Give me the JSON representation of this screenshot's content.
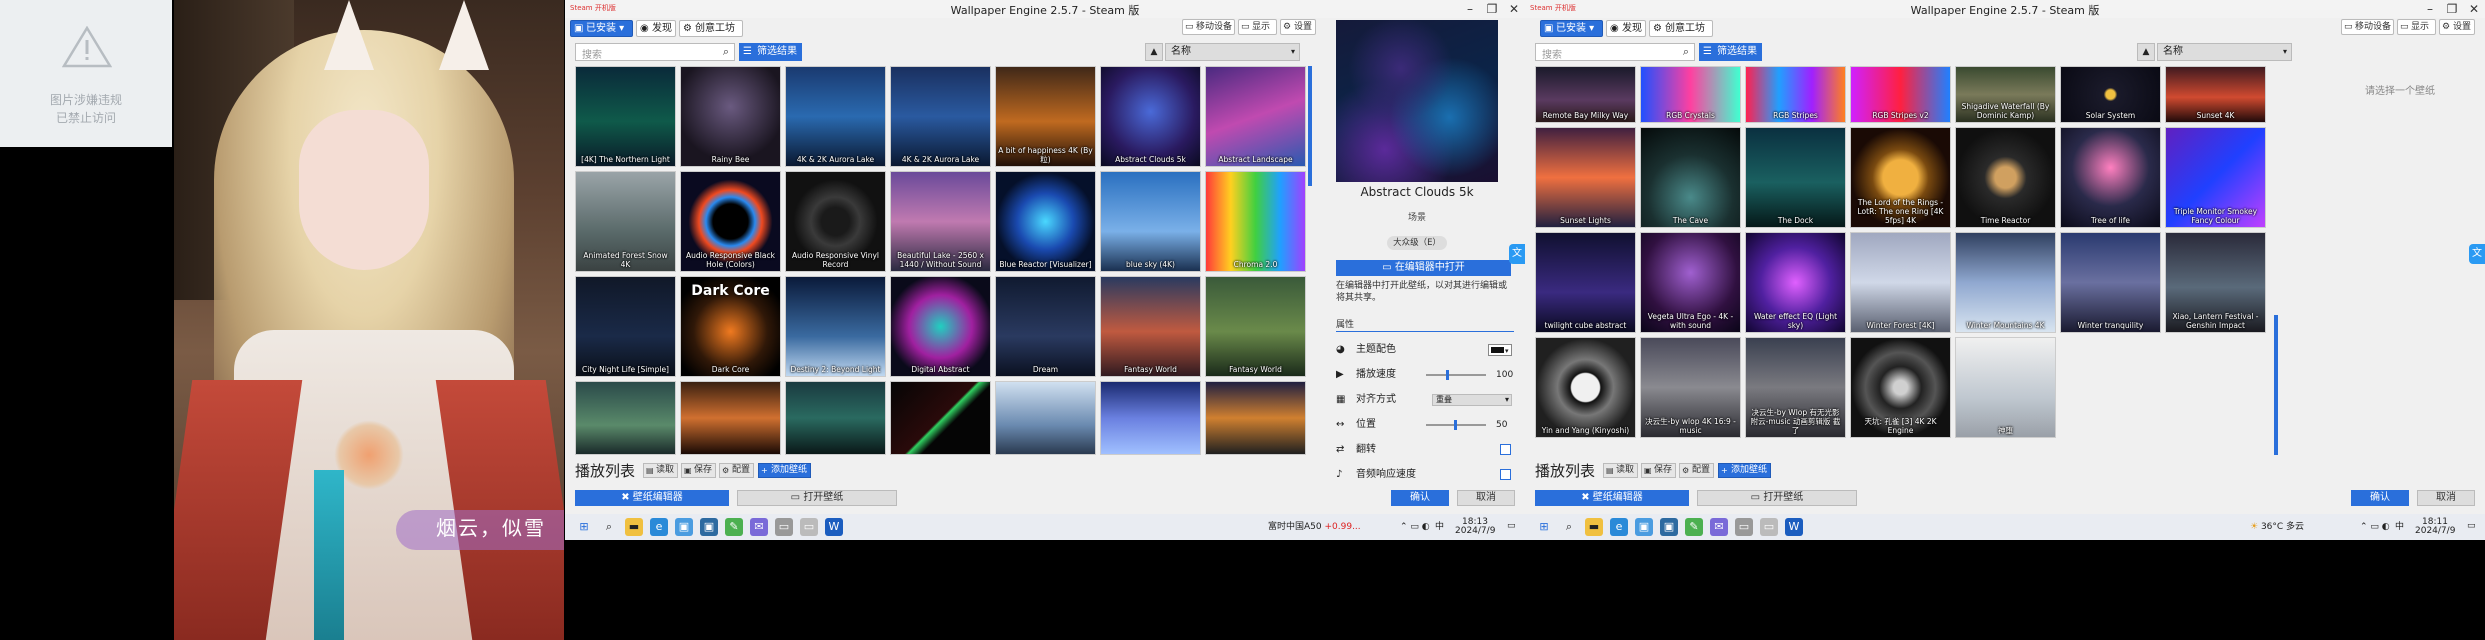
{
  "left_panel": {
    "broken_image": {
      "line1": "图片涉嫌违规",
      "line2": "已禁止访问"
    },
    "wallpaper_signature": "烟云，似雪"
  },
  "window_left": {
    "steam_tag": "Steam 开机版",
    "title": "Wallpaper Engine 2.5.7 - Steam 版",
    "tabs": {
      "installed": "已安装",
      "discover": "发现",
      "workshop": "创意工坊"
    },
    "right_buttons": {
      "move": "移动设备",
      "display": "显示",
      "settings": "设置"
    },
    "search_placeholder": "搜索",
    "filter_label": "筛选结果",
    "sort_label": "名称",
    "tiles": [
      "[4K] The Northern Light",
      "Rainy Bee",
      "4K & 2K Aurora Lake",
      "4K & 2K Aurora Lake",
      "A bit of happiness 4K (By 粒)",
      "Abstract Clouds 5k",
      "Abstract Landscape",
      "Animated Forest Snow 4K",
      "Audio Responsive Black Hole (Colors)",
      "Audio Responsive Vinyl Record",
      "Beautiful Lake - 2560 x 1440 / Without Sound",
      "Blue Reactor [Visualizer]",
      "blue sky (4K)",
      "Chroma 2.0",
      "City Night Life [Simple]",
      "Dark Core",
      "Destiny 2: Beyond Light",
      "Digital Abstract",
      "Dream",
      "Fantasy World",
      "Fantasy World",
      "",
      "",
      "",
      "",
      "",
      "",
      ""
    ],
    "dark_core_title": "Dark Core",
    "playlist": {
      "title": "播放列表",
      "load": "读取",
      "save": "保存",
      "configure": "配置",
      "add": "添加壁纸"
    },
    "bottom": {
      "editor": "壁纸编辑器",
      "open": "打开壁纸",
      "ok": "确认",
      "cancel": "取消"
    },
    "side": {
      "preview_title": "Abstract Clouds 5k",
      "type": "场景",
      "rating": "大众级（E）",
      "open_in_editor": "在编辑器中打开",
      "editor_desc": "在编辑器中打开此壁纸，以对其进行编辑或将其共享。",
      "props_header": "属性",
      "props": [
        {
          "icon": "palette-icon",
          "label": "主题配色"
        },
        {
          "icon": "play-icon",
          "label": "播放速度",
          "value": "100",
          "level": 1.0
        },
        {
          "icon": "align-icon",
          "label": "对齐方式",
          "value": "重叠"
        },
        {
          "icon": "position-icon",
          "label": "位置",
          "value": "50",
          "level": 0.5
        },
        {
          "icon": "flip-icon",
          "label": "翻转"
        },
        {
          "icon": "audio-icon",
          "label": "音频响应速度"
        }
      ]
    },
    "taskbar": {
      "stock": "富时中国A50",
      "stock_change": "+0.99...",
      "time": "18:13",
      "date": "2024/7/9",
      "ime": "中"
    }
  },
  "window_right": {
    "steam_tag": "Steam 开机版",
    "title": "Wallpaper Engine 2.5.7 - Steam 版",
    "tabs": {
      "installed": "已安装",
      "discover": "发现",
      "workshop": "创意工坊"
    },
    "right_buttons": {
      "move": "移动设备",
      "display": "显示",
      "settings": "设置"
    },
    "search_placeholder": "搜索",
    "filter_label": "筛选结果",
    "sort_label": "名称",
    "select_hint": "请选择一个壁纸",
    "tiles": [
      "Remote Bay Milky Way",
      "RGB Crystals",
      "RGB Stripes",
      "RGB Stripes v2",
      "Shigadive Waterfall (By Dominic Kamp)",
      "Solar System",
      "Sunset 4K",
      "Sunset Lights",
      "The Cave",
      "The Dock",
      "The Lord of the Rings - LotR: The one Ring [4K 5fps] 4K",
      "Time Reactor",
      "Tree of life",
      "Triple Monitor Smokey Fancy Colour",
      "twilight cube abstract",
      "Vegeta Ultra Ego - 4K - with sound",
      "Water effect EQ (Light sky)",
      "Winter Forest [4K]",
      "Winter Mountains 4K",
      "Winter tranquility",
      "Xiao, Lantern Festival - Genshin Impact",
      "Yin and Yang (Kinyoshi)",
      "决云生-by wlop 4K 16:9 - music",
      "决云生-by Wlop 有无光影 附云-music 动画剪辑版 截了",
      "天坑: 孔雀 [3] 4K 2K Engine",
      "神堕",
      "",
      ""
    ],
    "playlist": {
      "title": "播放列表",
      "load": "读取",
      "save": "保存",
      "configure": "配置",
      "add": "添加壁纸"
    },
    "bottom": {
      "editor": "壁纸编辑器",
      "open": "打开壁纸",
      "ok": "确认",
      "cancel": "取消"
    },
    "taskbar": {
      "weather": "36°C 多云",
      "time": "18:11",
      "date": "2024/7/9",
      "ime": "中"
    }
  }
}
